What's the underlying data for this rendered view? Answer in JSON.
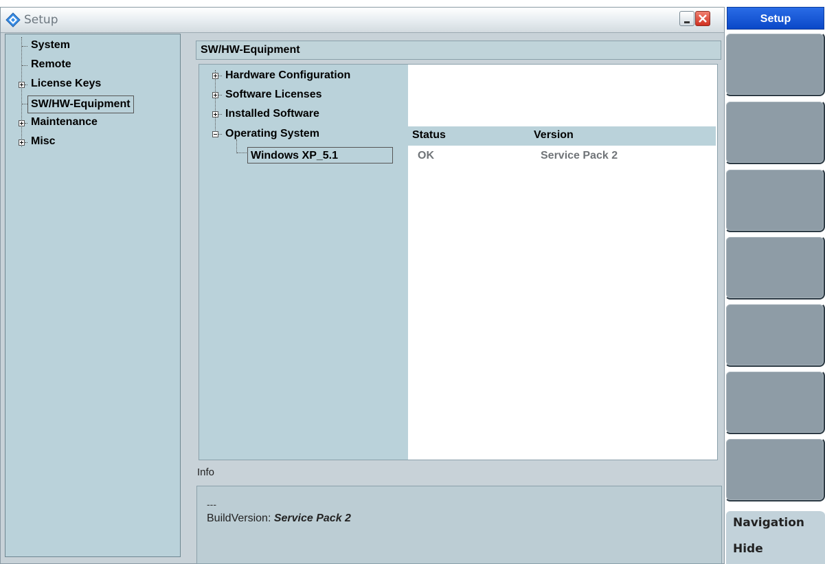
{
  "window": {
    "title": "Setup"
  },
  "sidebar": {
    "items": [
      {
        "label": "System"
      },
      {
        "label": "Remote"
      },
      {
        "label": "License Keys"
      },
      {
        "label": "SW/HW-Equipment"
      },
      {
        "label": "Maintenance"
      },
      {
        "label": "Misc"
      }
    ],
    "selected": "SW/HW-Equipment"
  },
  "main": {
    "header": "SW/HW-Equipment",
    "tree": [
      {
        "label": "Hardware Configuration"
      },
      {
        "label": "Software Licenses"
      },
      {
        "label": "Installed Software"
      },
      {
        "label": "Operating System"
      }
    ],
    "columns": {
      "status": "Status",
      "version": "Version"
    },
    "rows": [
      {
        "name": "Windows XP_5.1",
        "status": "OK",
        "version": "Service Pack 2"
      }
    ]
  },
  "info": {
    "label": "Info",
    "dashes": "---",
    "build_label": "BuildVersion:",
    "build_value": "Service Pack 2"
  },
  "softkeys": {
    "title": "Setup",
    "nav_line1": "Navigation",
    "nav_line2": "Hide"
  },
  "colors": {
    "accent": "#0a48c8",
    "panel": "#bad2da",
    "softkey": "#8e9ca6"
  }
}
